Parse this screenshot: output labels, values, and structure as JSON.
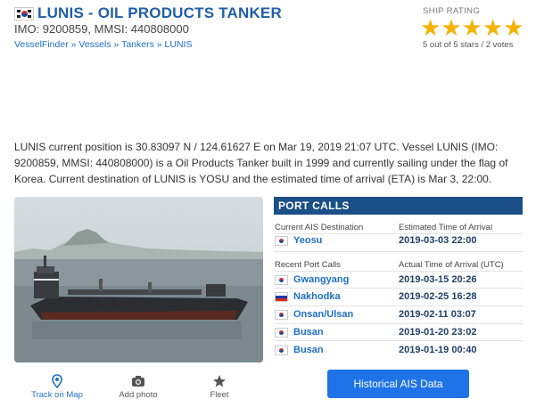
{
  "header": {
    "title": "LUNIS - OIL PRODUCTS TANKER",
    "ids": "IMO: 9200859, MMSI: 440808000",
    "breadcrumb": [
      "VesselFinder",
      "Vessels",
      "Tankers",
      "LUNIS"
    ],
    "breadcrumb_sep": " » "
  },
  "rating": {
    "label": "SHIP RATING",
    "stars": 5,
    "max_stars": 5,
    "summary": "5 out of 5 stars / 2 votes"
  },
  "description": "LUNIS current position is 30.83097 N / 124.61627 E on Mar 19, 2019 21:07 UTC. Vessel LUNIS (IMO: 9200859, MMSI: 440808000) is a Oil Products Tanker built in 1999 and currently sailing under the flag of Korea. Current destination of LUNIS is YOSU and the estimated time of arrival (ETA) is Mar 3, 22:00.",
  "photo_tabs": [
    {
      "label": "Track on Map",
      "icon": "map-pin-icon"
    },
    {
      "label": "Add photo",
      "icon": "camera-icon"
    },
    {
      "label": "Fleet",
      "icon": "star-icon"
    }
  ],
  "port_calls": {
    "heading": "PORT CALLS",
    "current_label": "Current AIS Destination",
    "eta_label": "Estimated Time of Arrival",
    "current": {
      "port": "Yeosu",
      "time": "2019-03-03 22:00",
      "flag": "kr"
    },
    "recent_label": "Recent Port Calls",
    "ata_label": "Actual Time of Arrival (UTC)",
    "recent": [
      {
        "port": "Gwangyang",
        "time": "2019-03-15 20:26",
        "flag": "kr"
      },
      {
        "port": "Nakhodka",
        "time": "2019-02-25 16:28",
        "flag": "ru"
      },
      {
        "port": "Onsan/Ulsan",
        "time": "2019-02-11 03:07",
        "flag": "kr"
      },
      {
        "port": "Busan",
        "time": "2019-01-20 23:02",
        "flag": "kr"
      },
      {
        "port": "Busan",
        "time": "2019-01-19 00:40",
        "flag": "kr"
      }
    ],
    "history_button": "Historical AIS Data"
  },
  "colors": {
    "brand_blue": "#1f5fa8",
    "header_bar": "#1a4f87",
    "button": "#1f73e8",
    "star": "#f5b301"
  }
}
